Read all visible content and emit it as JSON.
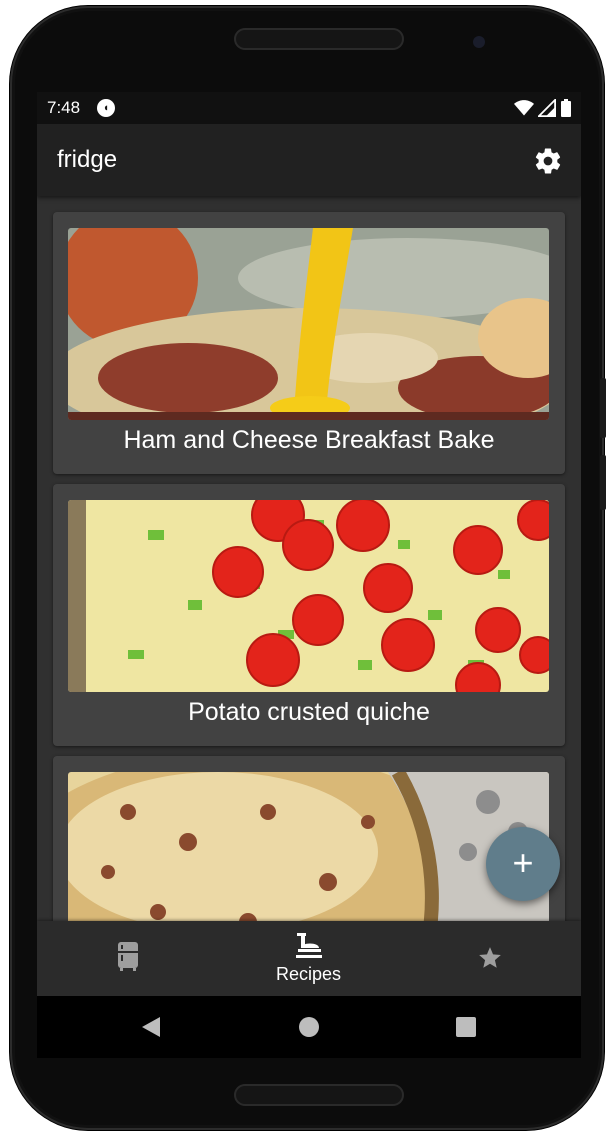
{
  "status_bar": {
    "time": "7:48",
    "app_icon": "notification-app-icon",
    "icons": [
      "wifi-icon",
      "cell-signal-icon",
      "battery-icon"
    ]
  },
  "app_bar": {
    "title": "fridge",
    "action_icon": "gear-icon"
  },
  "recipes": [
    {
      "title": "Ham and Cheese Breakfast Bake"
    },
    {
      "title": "Potato crusted quiche"
    },
    {
      "title": ""
    }
  ],
  "fab": {
    "label": "+"
  },
  "bottom_nav": {
    "items": [
      {
        "icon": "fridge-icon",
        "label": ""
      },
      {
        "icon": "chef-hat-icon",
        "label": "Recipes",
        "selected": true
      },
      {
        "icon": "star-icon",
        "label": ""
      }
    ]
  },
  "system_nav": [
    "back-icon",
    "home-icon",
    "recents-icon"
  ],
  "colors": {
    "appbar": "#212121",
    "background": "#303030",
    "card": "#424242",
    "fab": "#607d8b",
    "bottom_nav": "#2b2b2b"
  }
}
